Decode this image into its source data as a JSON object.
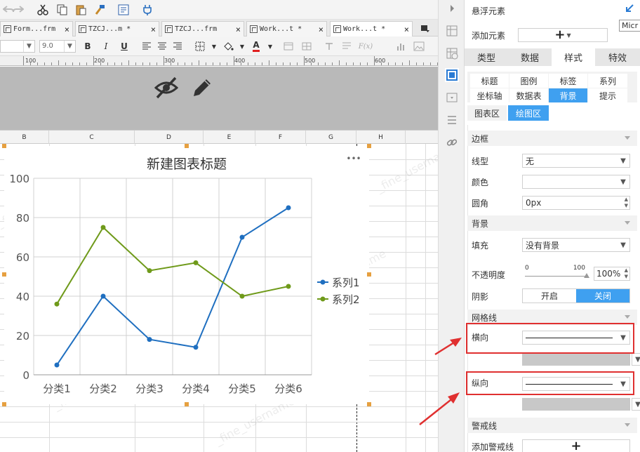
{
  "tabs": [
    {
      "label": "Form...frm",
      "close": "×"
    },
    {
      "label": "TZCJ...m *",
      "close": "×"
    },
    {
      "label": "TZCJ...frm",
      "close": "×"
    },
    {
      "label": "Work...t *",
      "close": "×"
    },
    {
      "label": "Work...t *",
      "close": "×"
    }
  ],
  "format_toolbar": {
    "font_size": "9.0",
    "bold": "B",
    "italic": "I",
    "underline": "U",
    "font_color_glyph": "A",
    "formula_glyph": "F(x)"
  },
  "ruler": {
    "marks": [
      "100",
      "200",
      "300",
      "400",
      "500",
      "600"
    ]
  },
  "columns": [
    "B",
    "C",
    "D",
    "E",
    "F",
    "G",
    "H"
  ],
  "watermark": "_fine_username",
  "chart_data": {
    "type": "line",
    "title": "新建图表标题",
    "more": "•••",
    "categories": [
      "分类1",
      "分类2",
      "分类3",
      "分类4",
      "分类5",
      "分类6"
    ],
    "series": [
      {
        "name": "系列1",
        "color": "#1f6fc0",
        "values": [
          5,
          40,
          18,
          14,
          70,
          85
        ]
      },
      {
        "name": "系列2",
        "color": "#6f9a1a",
        "values": [
          36,
          75,
          53,
          57,
          40,
          45
        ]
      }
    ],
    "yticks": [
      0,
      20,
      40,
      60,
      80,
      100
    ],
    "ylim": [
      0,
      100
    ],
    "grid": true,
    "legend": "right"
  },
  "panel": {
    "title": "悬浮元素",
    "add_element_label": "添加元素",
    "add_symbol": "+",
    "main_tabs": [
      "类型",
      "数据",
      "样式",
      "特效"
    ],
    "sub_tabs_row1": [
      "标题",
      "图例",
      "标签",
      "系列"
    ],
    "sub_tabs_row2": [
      "坐标轴",
      "数据表",
      "背景",
      "提示"
    ],
    "area_tabs": [
      "图表区",
      "绘图区"
    ],
    "border_section": "边框",
    "line_type_label": "线型",
    "line_type_value": "无",
    "color_label": "颜色",
    "radius_label": "圆角",
    "radius_value": "0px",
    "background_section": "背景",
    "fill_label": "填充",
    "fill_value": "没有背景",
    "opacity_label": "不透明度",
    "opacity_min": "0",
    "opacity_max": "100",
    "opacity_value": "100%",
    "shadow_label": "阴影",
    "shadow_on": "开启",
    "shadow_off": "关闭",
    "gridline_section": "网格线",
    "horizontal_label": "横向",
    "vertical_label": "纵向",
    "warning_section": "警戒线",
    "add_warning_label": "添加警戒线",
    "tooltip": "Micr"
  }
}
